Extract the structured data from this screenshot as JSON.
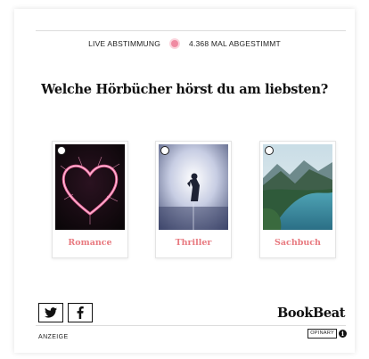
{
  "status": {
    "live_label": "LIVE ABSTIMMUNG",
    "vote_count_label": "4.368 MAL ABGESTIMMT"
  },
  "poll": {
    "question": "Welche Hörbücher hörst du am liebsten?",
    "options": [
      {
        "label": "Romance",
        "image": "heart-sparkler-image"
      },
      {
        "label": "Thriller",
        "image": "foggy-figure-image"
      },
      {
        "label": "Sachbuch",
        "image": "mountain-lake-image"
      }
    ]
  },
  "footer": {
    "brand": "BookBeat",
    "ad_label": "ANZEIGE",
    "provider_logo": "OPINARY",
    "share_icons": [
      "twitter-icon",
      "facebook-icon"
    ]
  },
  "colors": {
    "option_label": "#e8797f",
    "live_dot": "#f08aa2"
  }
}
